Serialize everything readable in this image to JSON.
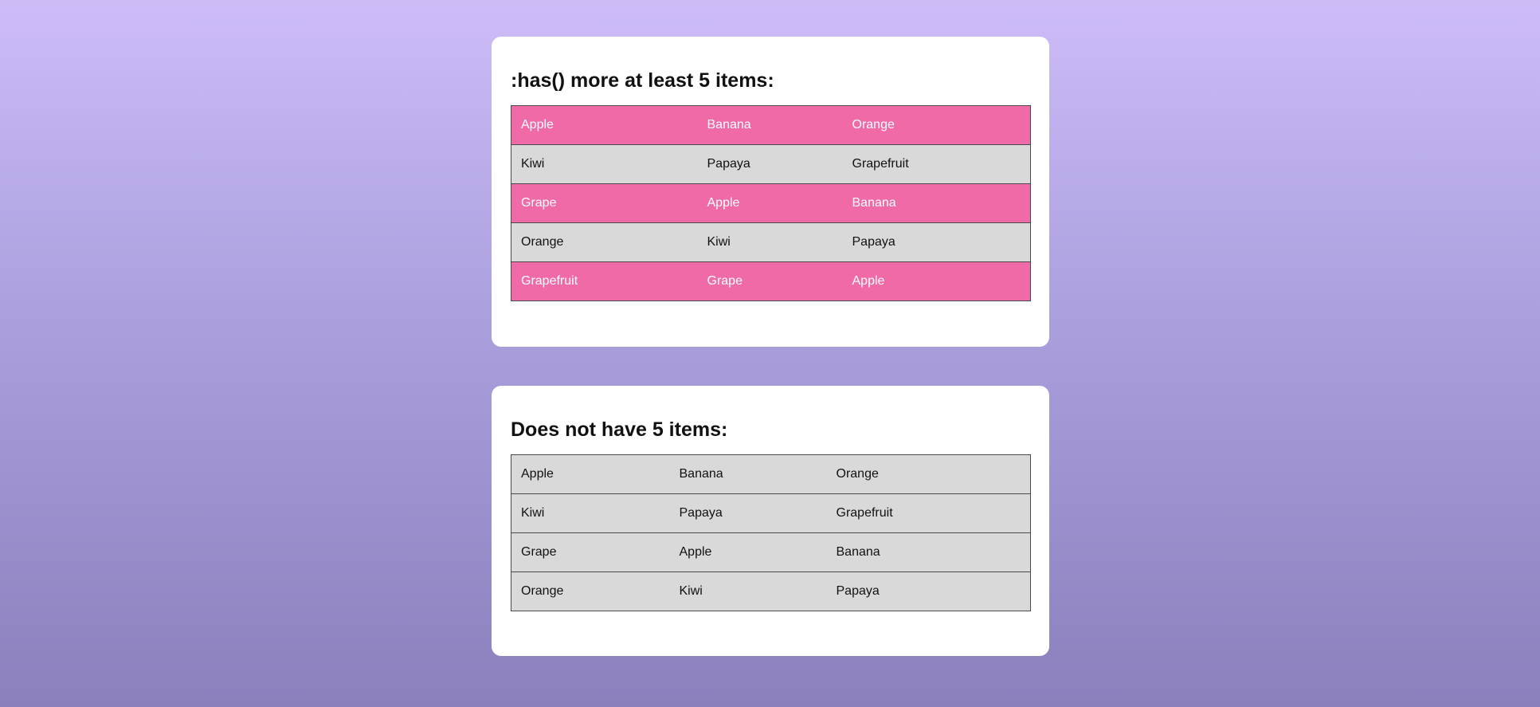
{
  "cards": [
    {
      "title": ":has() more at least 5 items:",
      "highlight_color": "#f06aa8",
      "rows": [
        [
          "Apple",
          "Banana",
          "Orange"
        ],
        [
          "Kiwi",
          "Papaya",
          "Grapefruit"
        ],
        [
          "Grape",
          "Apple",
          "Banana"
        ],
        [
          "Orange",
          "Kiwi",
          "Papaya"
        ],
        [
          "Grapefruit",
          "Grape",
          "Apple"
        ]
      ]
    },
    {
      "title": "Does not have 5 items:",
      "rows": [
        [
          "Apple",
          "Banana",
          "Orange"
        ],
        [
          "Kiwi",
          "Papaya",
          "Grapefruit"
        ],
        [
          "Grape",
          "Apple",
          "Banana"
        ],
        [
          "Orange",
          "Kiwi",
          "Papaya"
        ]
      ]
    }
  ],
  "colors": {
    "background_top": "#cdbcf7",
    "background_bottom": "#8b80bc",
    "card": "#ffffff",
    "cell_default": "#d9d9d9",
    "cell_highlight": "#f06aa8"
  }
}
